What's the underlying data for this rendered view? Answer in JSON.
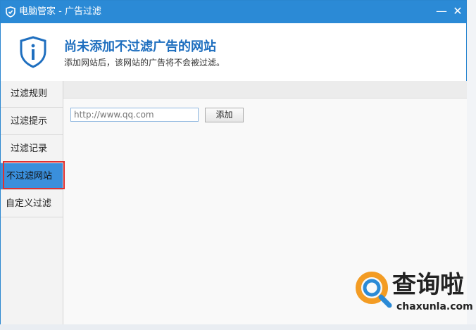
{
  "window": {
    "title": "电脑管家 - 广告过滤",
    "minimize_symbol": "—",
    "close_symbol": "✕"
  },
  "banner": {
    "title": "尚未添加不过滤广告的网站",
    "subtitle": "添加网站后，该网站的广告将不会被过滤。"
  },
  "sidebar": {
    "items": [
      {
        "label": "过滤规则",
        "active": false
      },
      {
        "label": "过滤提示",
        "active": false
      },
      {
        "label": "过滤记录",
        "active": false
      },
      {
        "label": "不过滤网站",
        "active": true
      },
      {
        "label": "自定义过滤",
        "active": false
      }
    ]
  },
  "main": {
    "url_placeholder": "http://www.qq.com",
    "add_label": "添加"
  },
  "watermark": {
    "text": "查询啦",
    "subtext": "chaxunla.com"
  },
  "colors": {
    "accent": "#2b8ad6",
    "active_nav": "#3a8fdc",
    "highlight": "#e03131",
    "banner_title": "#1f6fbf"
  },
  "icons": {
    "title": "shield-icon",
    "banner": "shield-info-icon",
    "watermark": "magnifier-q-icon"
  }
}
